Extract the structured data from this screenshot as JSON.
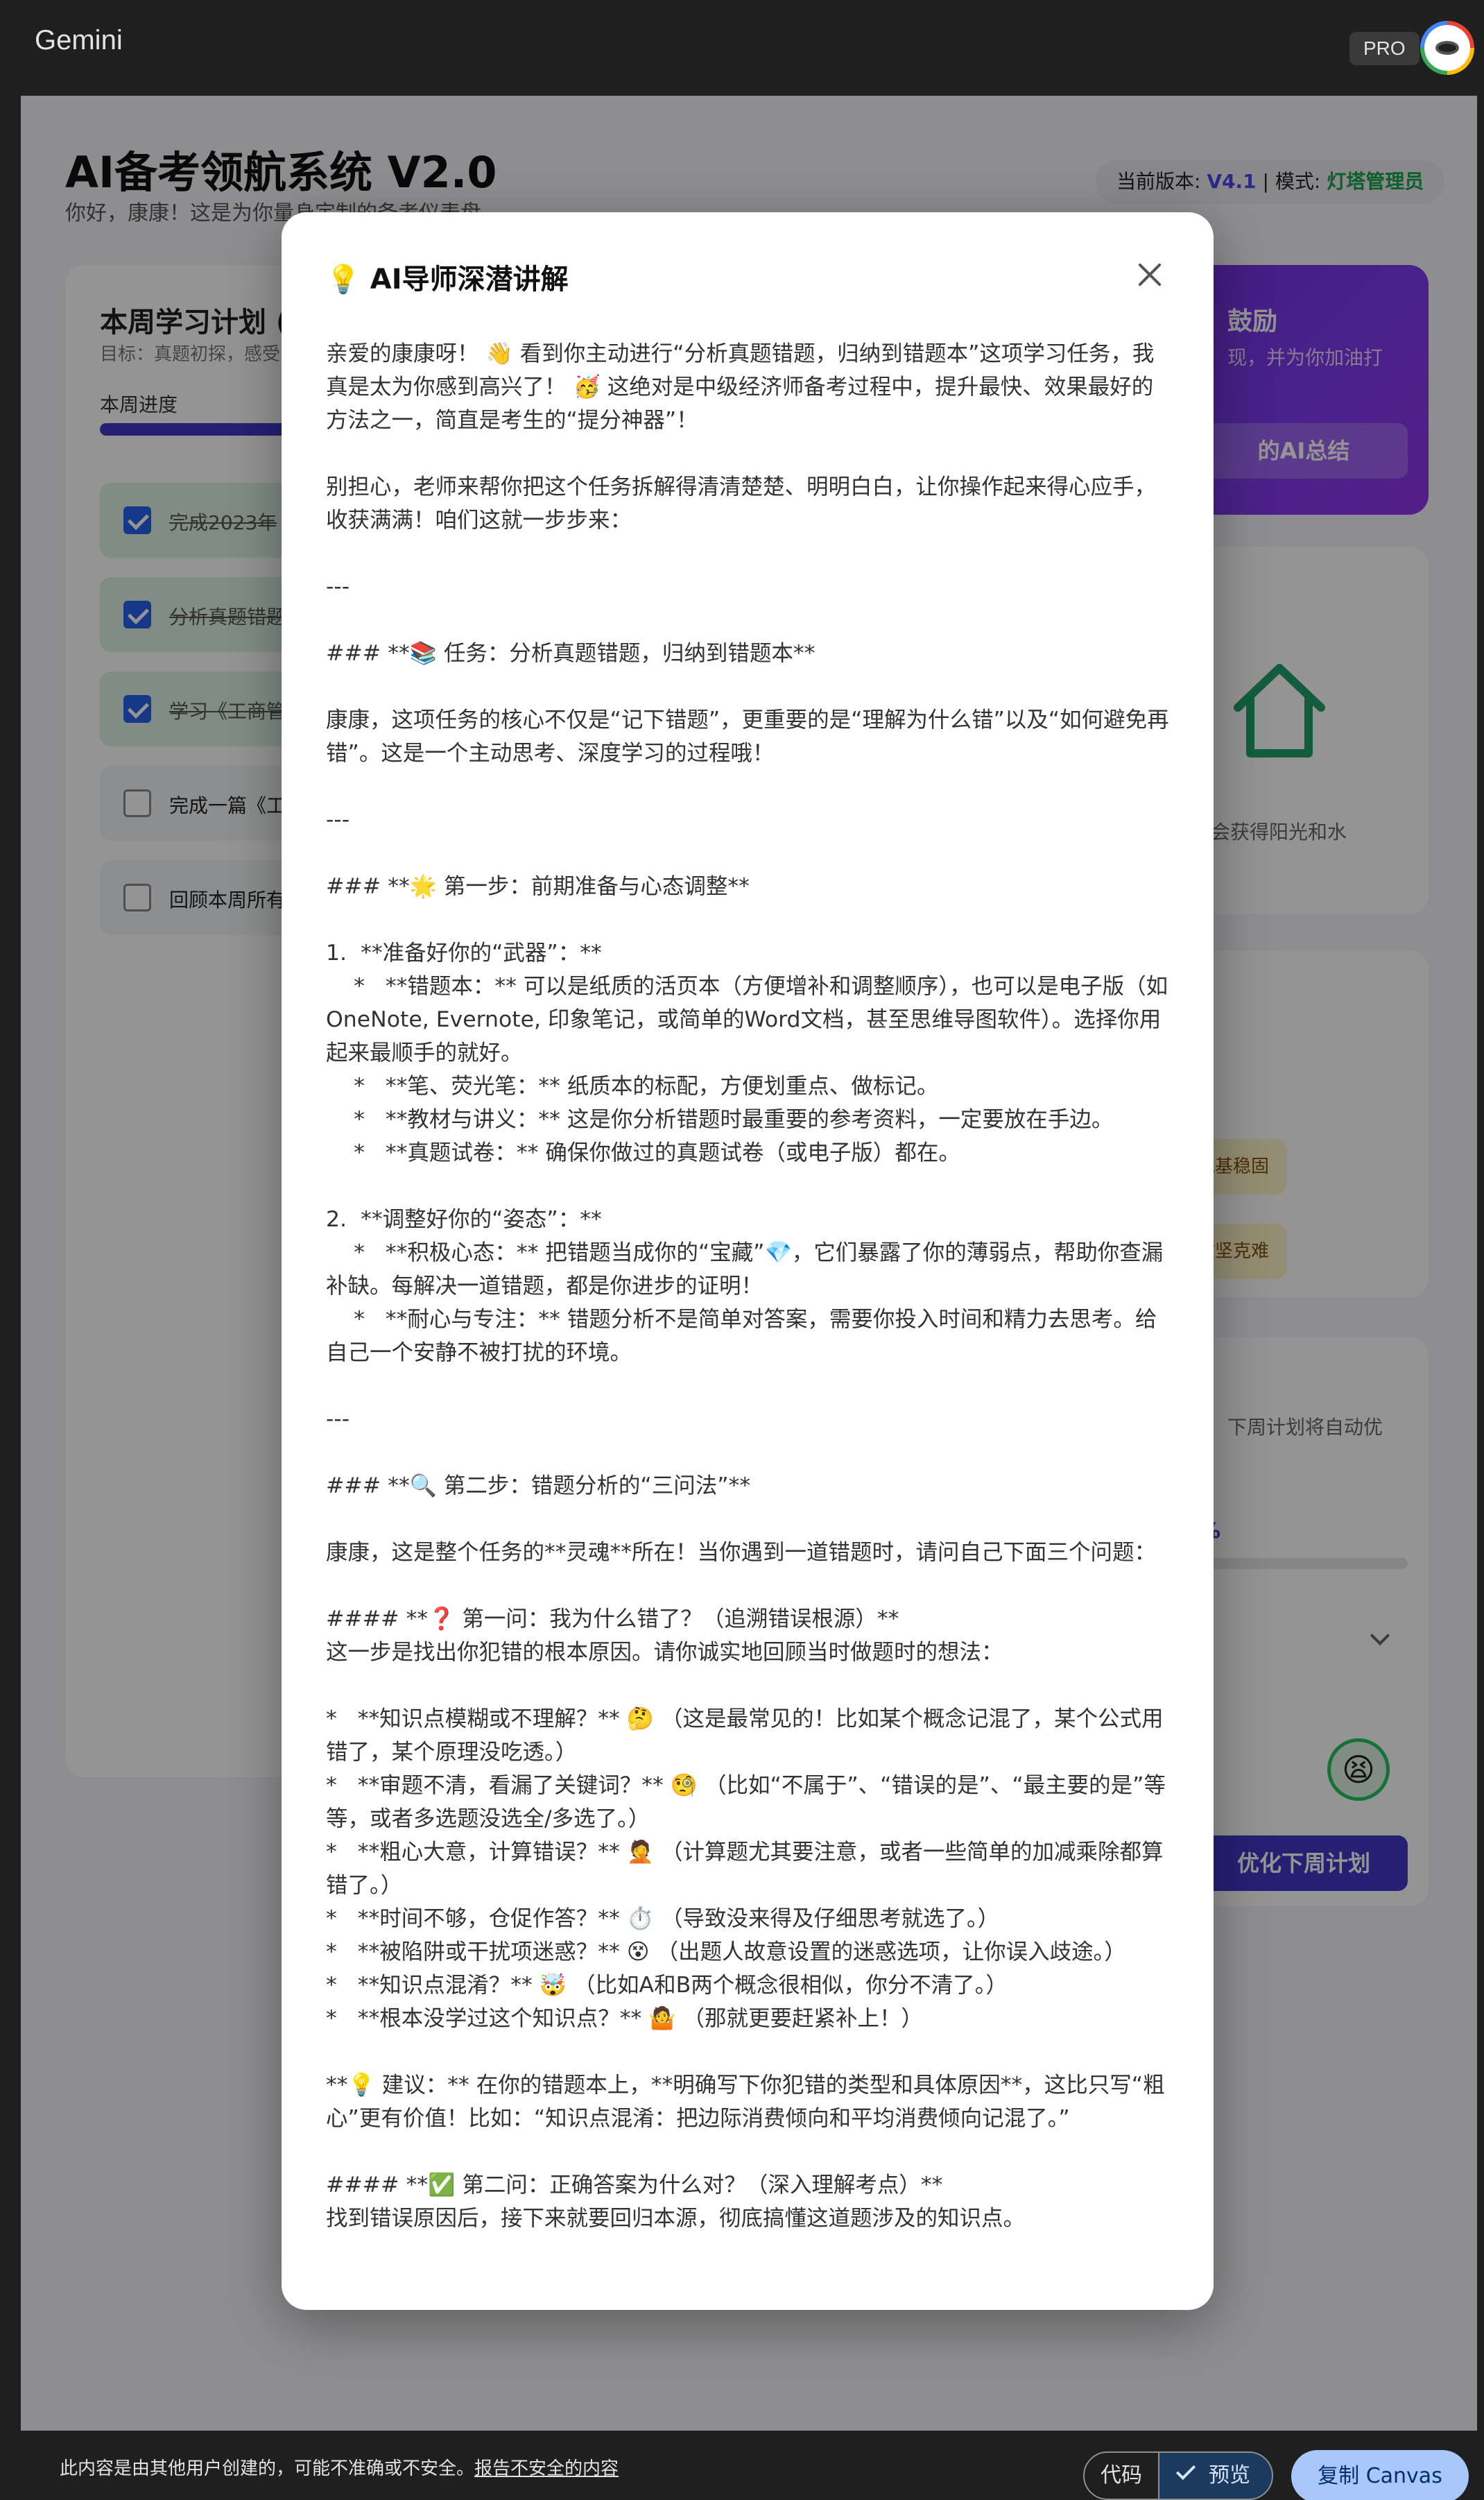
{
  "topbar": {
    "brand": "Gemini",
    "pro_badge": "PRO"
  },
  "app": {
    "title": "AI备考领航系统 V2.0",
    "subtitle": "你好，康康！这是为你量身定制的备考仪表盘",
    "version_label": "当前版本: ",
    "version_value": "V4.1",
    "mode_label": " | 模式: ",
    "mode_value": "灯塔管理员",
    "plan": {
      "title": "本周学习计划 (",
      "goal": "目标：真题初探，感受",
      "progress_label": "本周进度",
      "progress": 0.6,
      "tasks": [
        {
          "label": "完成2023年",
          "done": true
        },
        {
          "label": "分析真题错题",
          "done": true
        },
        {
          "label": "学习《工商管",
          "done": true
        },
        {
          "label": "完成一篇《工",
          "done": false
        },
        {
          "label": "回顾本周所有",
          "done": false
        }
      ]
    },
    "ai_card": {
      "title": "鼓励",
      "subtitle": "现，并为你加油打",
      "button": "的AI总结"
    },
    "plant_card": {
      "text": "时都会获得阳光和水",
      "text2": "！"
    },
    "badges": [
      "地基稳固",
      "攻坚克难"
    ],
    "next_card": {
      "subtitle": "下周计划将自动优",
      "percent": "%",
      "mood": "😫",
      "button": "优化下周计划"
    }
  },
  "modal": {
    "title": "💡 AI导师深潜讲解",
    "paragraphs": [
      "亲爱的康康呀！ 👋 看到你主动进行“分析真题错题，归纳到错题本”这项学习任务，我真是太为你感到高兴了！ 🥳 这绝对是中级经济师备考过程中，提升最快、效果最好的方法之一，简直是考生的“提分神器”！",
      "",
      "别担心，老师来帮你把这个任务拆解得清清楚楚、明明白白，让你操作起来得心应手，收获满满！咱们这就一步步来：",
      "",
      "---",
      "",
      "### **📚 任务：分析真题错题，归纳到错题本**",
      "",
      "康康，这项任务的核心不仅是“记下错题”，更重要的是“理解为什么错”以及“如何避免再错”。这是一个主动思考、深度学习的过程哦！",
      "",
      "---",
      "",
      "### **🌟 第一步：前期准备与心态调整**",
      "",
      "1.  **准备好你的“武器”：**",
      "    *   **错题本：** 可以是纸质的活页本（方便增补和调整顺序），也可以是电子版（如OneNote, Evernote, 印象笔记，或简单的Word文档，甚至思维导图软件）。选择你用起来最顺手的就好。",
      "    *   **笔、荧光笔：** 纸质本的标配，方便划重点、做标记。",
      "    *   **教材与讲义：** 这是你分析错题时最重要的参考资料，一定要放在手边。",
      "    *   **真题试卷：** 确保你做过的真题试卷（或电子版）都在。",
      "",
      "2.  **调整好你的“姿态”：**",
      "    *   **积极心态：** 把错题当成你的“宝藏”💎，它们暴露了你的薄弱点，帮助你查漏补缺。每解决一道错题，都是你进步的证明！",
      "    *   **耐心与专注：** 错题分析不是简单对答案，需要你投入时间和精力去思考。给自己一个安静不被打扰的环境。",
      "",
      "---",
      "",
      "### **🔍 第二步：错题分析的“三问法”**",
      "",
      "康康，这是整个任务的**灵魂**所在！当你遇到一道错题时，请问自己下面三个问题：",
      "",
      "#### **❓ 第一问：我为什么错了？（追溯错误根源）**",
      "这一步是找出你犯错的根本原因。请你诚实地回顾当时做题时的想法：",
      "",
      "*   **知识点模糊或不理解？** 🤔 （这是最常见的！比如某个概念记混了，某个公式用错了，某个原理没吃透。）",
      "*   **审题不清，看漏了关键词？** 🧐 （比如“不属于”、“错误的是”、“最主要的是”等等，或者多选题没选全/多选了。）",
      "*   **粗心大意，计算错误？** 🤦 （计算题尤其要注意，或者一些简单的加减乘除都算错了。）",
      "*   **时间不够，仓促作答？** ⏱️ （导致没来得及仔细思考就选了。）",
      "*   **被陷阱或干扰项迷惑？** 😵 （出题人故意设置的迷惑选项，让你误入歧途。）",
      "*   **知识点混淆？** 🤯 （比如A和B两个概念很相似，你分不清了。）",
      "*   **根本没学过这个知识点？** 🤷 （那就更要赶紧补上！）",
      "",
      "**💡 建议：** 在你的错题本上，**明确写下你犯错的类型和具体原因**，这比只写“粗心”更有价值！比如：“知识点混淆：把边际消费倾向和平均消费倾向记混了。”",
      "",
      "#### **✅ 第二问：正确答案为什么对？（深入理解考点）**",
      "找到错误原因后，接下来就要回归本源，彻底搞懂这道题涉及的知识点。"
    ]
  },
  "footer": {
    "disclaimer": "此内容是由其他用户创建的，可能不准确或不安全。",
    "report_link": "报告不安全的内容",
    "code_label": "代码",
    "preview_label": "预览",
    "copy_label": "复制 Canvas"
  }
}
